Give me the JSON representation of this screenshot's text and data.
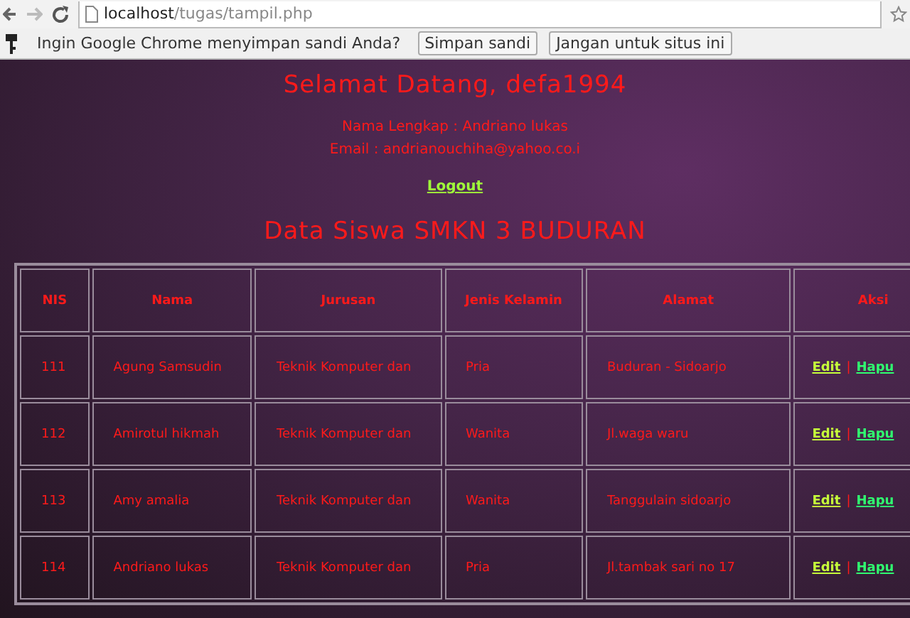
{
  "browser": {
    "url_host": "localhost",
    "url_path": "/tugas/tampil.php"
  },
  "infobar": {
    "message": "Ingin Google Chrome menyimpan sandi Anda?",
    "buttons": [
      "Simpan sandi",
      "Jangan untuk situs ini"
    ]
  },
  "header": {
    "greeting": "Selamat Datang, defa1994",
    "full_name": "Nama Lengkap : Andriano lukas",
    "email": "Email : andrianouchiha@yahoo.co.i",
    "logout": "Logout"
  },
  "table": {
    "title": "Data Siswa SMKN 3 BUDURAN",
    "columns": [
      "NIS",
      "Nama",
      "Jurusan",
      "Jenis Kelamin",
      "Alamat",
      "Aksi"
    ],
    "rows": [
      {
        "nis": "111",
        "nama": "Agung Samsudin",
        "jurusan": "Teknik Komputer dan",
        "jenis_kelamin": "Pria",
        "alamat": "Buduran - Sidoarjo",
        "actions": [
          {
            "kind": "edit",
            "label": "Edit"
          },
          {
            "kind": "delete",
            "label": "Hapu"
          }
        ],
        "separator": "|"
      },
      {
        "nis": "112",
        "nama": "Amirotul hikmah",
        "jurusan": "Teknik Komputer dan",
        "jenis_kelamin": "Wanita",
        "alamat": "Jl.waga waru",
        "actions": [
          {
            "kind": "edit",
            "label": "Edit"
          },
          {
            "kind": "delete",
            "label": "Hapu"
          }
        ],
        "separator": "|"
      },
      {
        "nis": "113",
        "nama": "Amy amalia",
        "jurusan": "Teknik Komputer dan",
        "jenis_kelamin": "Wanita",
        "alamat": "Tanggulain sidoarjo",
        "actions": [
          {
            "kind": "edit",
            "label": "Edit"
          },
          {
            "kind": "delete",
            "label": "Hapu"
          }
        ],
        "separator": "|"
      },
      {
        "nis": "114",
        "nama": "Andriano lukas",
        "jurusan": "Teknik Komputer dan",
        "jenis_kelamin": "Pria",
        "alamat": "Jl.tambak sari no 17",
        "actions": [
          {
            "kind": "edit",
            "label": "Edit"
          },
          {
            "kind": "delete",
            "label": "Hapu"
          }
        ],
        "separator": "|"
      }
    ]
  }
}
